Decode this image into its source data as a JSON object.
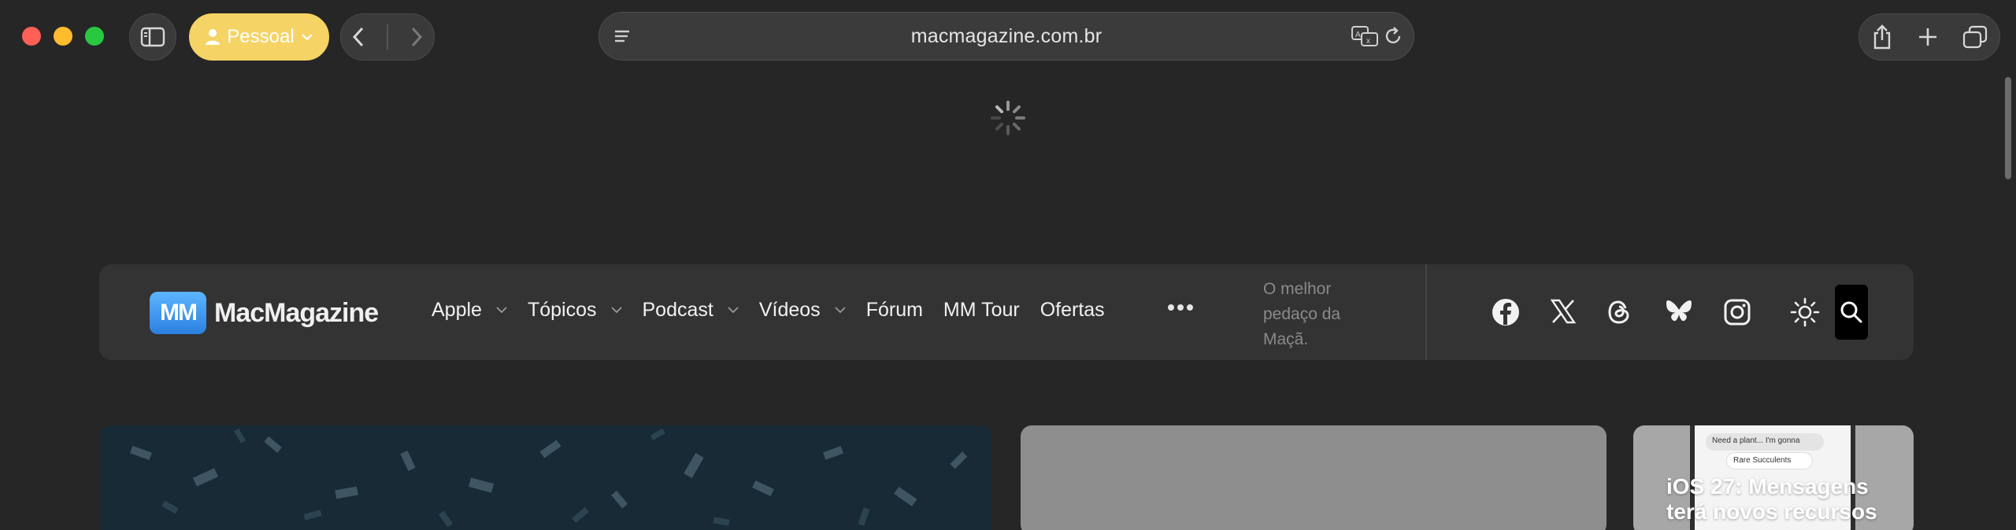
{
  "browser": {
    "profile_label": "Pessoal",
    "url": "macmagazine.com.br"
  },
  "site": {
    "logo_text": "MacMagazine",
    "logo_mark": "MM",
    "nav": [
      {
        "label": "Apple",
        "has_dropdown": true
      },
      {
        "label": "Tópicos",
        "has_dropdown": true
      },
      {
        "label": "Podcast",
        "has_dropdown": true
      },
      {
        "label": "Vídeos",
        "has_dropdown": true
      },
      {
        "label": "Fórum",
        "has_dropdown": false
      },
      {
        "label": "MM Tour",
        "has_dropdown": false
      },
      {
        "label": "Ofertas",
        "has_dropdown": false
      }
    ],
    "tagline": "O melhor pedaço da Maçã.",
    "social_icons": [
      "facebook-icon",
      "x-icon",
      "threads-icon",
      "bluesky-icon",
      "instagram-icon"
    ]
  },
  "cards": {
    "ios_title": "iOS 27: Mensagens terá novos recursos",
    "phone_bubble_1": "Need a plant... I'm gonna",
    "phone_bubble_2": "Rare Succulents"
  },
  "colors": {
    "window_bg": "#262626",
    "profile_accent": "#f6d365",
    "sitebar_bg": "#333333"
  }
}
